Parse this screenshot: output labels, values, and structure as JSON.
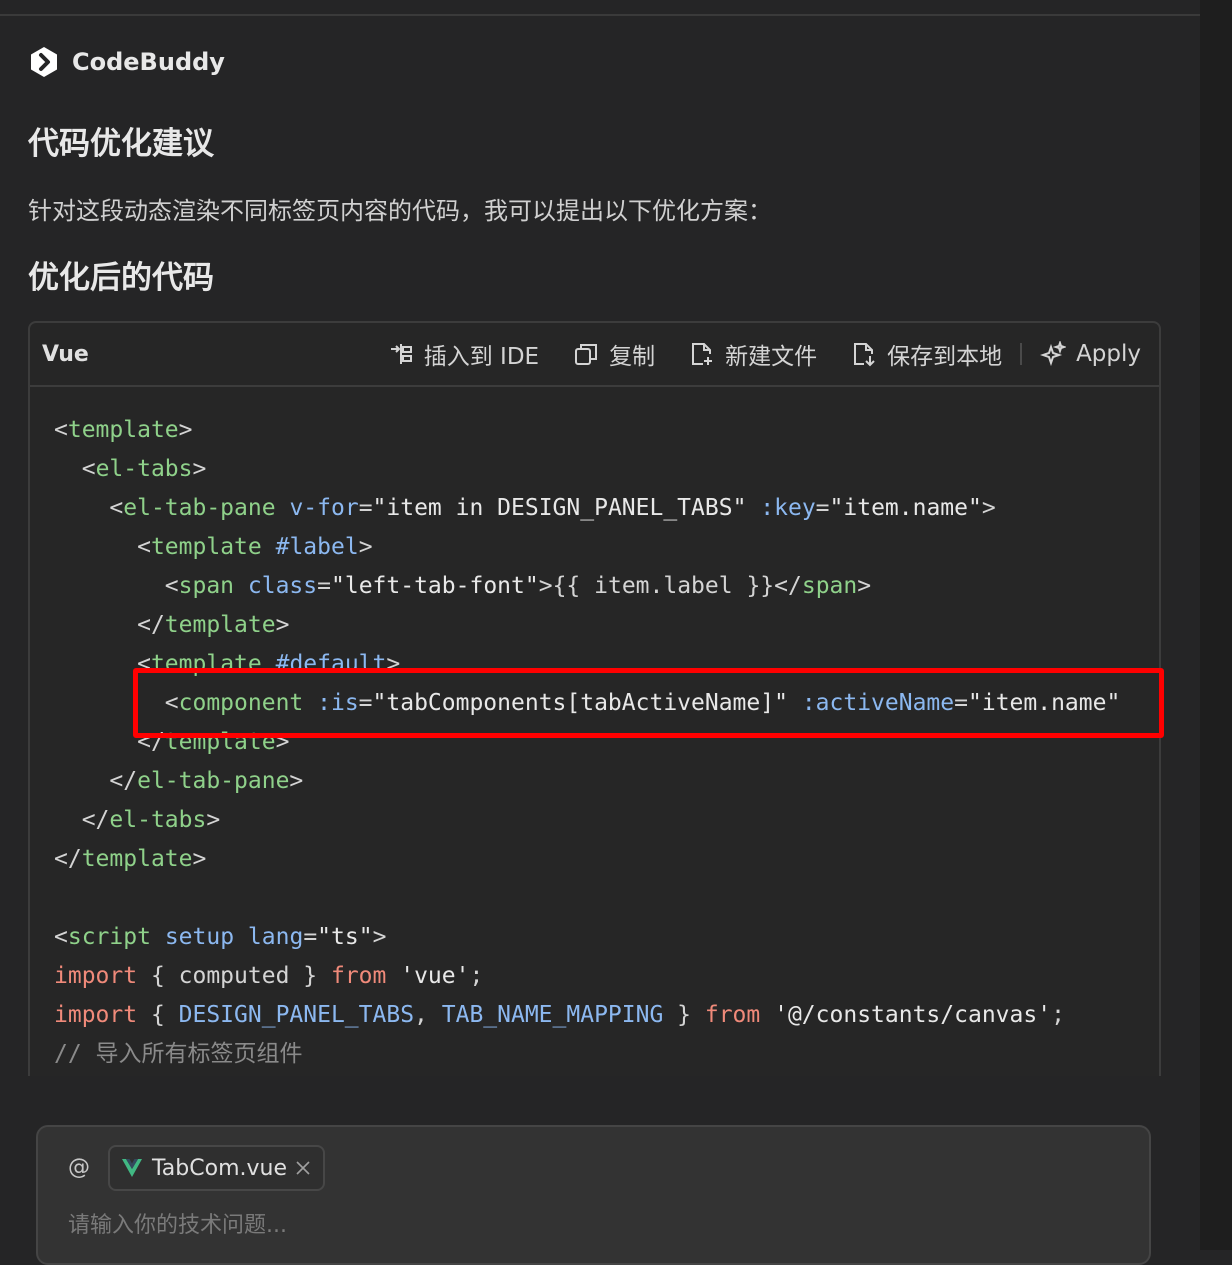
{
  "header": {
    "brand": "CodeBuddy"
  },
  "content": {
    "heading1": "代码优化建议",
    "paragraph": "针对这段动态渲染不同标签页内容的代码，我可以提出以下优化方案：",
    "heading2": "优化后的代码"
  },
  "code_block": {
    "language": "Vue",
    "toolbar": {
      "insert_label": "插入到 IDE",
      "copy_label": "复制",
      "new_file_label": "新建文件",
      "save_label": "保存到本地",
      "apply_label": "Apply"
    },
    "lines": [
      "<template>",
      "  <el-tabs>",
      "    <el-tab-pane v-for=\"item in DESIGN_PANEL_TABS\" :key=\"item.name\">",
      "      <template #label>",
      "        <span class=\"left-tab-font\">{{ item.label }}</span>",
      "      </template>",
      "      <template #default>",
      "        <component :is=\"tabComponents[tabActiveName]\" :activeName=\"item.name\"",
      "      </template>",
      "    </el-tab-pane>",
      "  </el-tabs>",
      "</template>",
      "",
      "<script setup lang=\"ts\">",
      "import { computed } from 'vue';",
      "import { DESIGN_PANEL_TABS, TAB_NAME_MAPPING } from '@/constants/canvas';",
      "// 导入所有标签页组件"
    ]
  },
  "composer": {
    "at_symbol": "@",
    "attached_file": "TabCom.vue",
    "placeholder": "请输入你的技术问题..."
  },
  "colors": {
    "background": "#252526",
    "highlight_border": "#ff0000",
    "tag_green": "#8fd18a",
    "attr_blue": "#8cb8f0",
    "keyword_red": "#f08a7a"
  }
}
